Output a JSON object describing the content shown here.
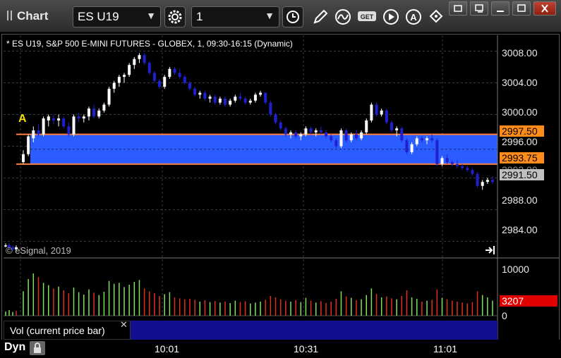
{
  "window": {
    "title": "Chart",
    "symbol": "ES U19",
    "interval": "1"
  },
  "chart": {
    "description": "* ES U19, S&P 500 E-MINI FUTURES - GLOBEX, 1, 09:30-16:15 (Dynamic)",
    "copyright": "© eSignal, 2019",
    "marker": "A",
    "price_axis": [
      "3008.00",
      "3004.00",
      "3000.00",
      "2996.00",
      "2988.00",
      "2984.00"
    ],
    "tags": {
      "upper": "2997.50",
      "lower": "2993.75",
      "last": "2991.50",
      "hidden": "2992.00"
    },
    "volume_axis": [
      "10000",
      "0"
    ],
    "volume_tag": "3207",
    "volume_label": "Vol (current price bar)",
    "time_axis": [
      "10:01",
      "10:31",
      "11:01"
    ],
    "status": "Dyn"
  },
  "colors": {
    "up": "#ffffff",
    "down": "#2020d0",
    "band": "#2a5cff",
    "band_line": "#ff8040",
    "vol_up": "#80e060",
    "vol_down": "#e03020",
    "last_tag": "#c0c0c0",
    "volume_tag": "#e00000"
  },
  "chart_data": {
    "type": "candlestick",
    "title": "* ES U19, S&P 500 E-MINI FUTURES - GLOBEX, 1, 09:30-16:15 (Dynamic)",
    "ylim": [
      2982,
      3010
    ],
    "band": {
      "low": 2993.75,
      "high": 2997.5
    },
    "candles": [
      [
        2983.5,
        2983.75,
        2983.25,
        2983.5
      ],
      [
        2983.5,
        2983.75,
        2983.0,
        2983.25
      ],
      [
        2983.25,
        2983.5,
        2982.75,
        2983.0
      ],
      [
        2983.0,
        2983.5,
        2982.75,
        2983.25
      ],
      [
        2994.0,
        2995.5,
        2993.75,
        2995.0
      ],
      [
        2995.0,
        2997.5,
        2994.75,
        2997.25
      ],
      [
        2997.0,
        2998.5,
        2996.5,
        2998.0
      ],
      [
        2998.0,
        2998.75,
        2997.25,
        2997.5
      ],
      [
        2997.5,
        2999.75,
        2997.25,
        2999.5
      ],
      [
        2999.25,
        3000.0,
        2998.5,
        2999.75
      ],
      [
        2999.5,
        3000.0,
        2998.75,
        2999.25
      ],
      [
        2999.25,
        3000.0,
        2998.5,
        2999.5
      ],
      [
        2999.5,
        2999.75,
        2998.25,
        2998.5
      ],
      [
        2998.5,
        2999.0,
        2997.25,
        2997.5
      ],
      [
        2997.5,
        3000.0,
        2997.25,
        2999.75
      ],
      [
        2999.75,
        3000.25,
        2999.0,
        2999.5
      ],
      [
        2999.5,
        3000.0,
        2999.0,
        2999.75
      ],
      [
        2999.75,
        3001.0,
        2999.25,
        3000.75
      ],
      [
        3000.75,
        3001.25,
        2999.5,
        2999.75
      ],
      [
        2999.75,
        3000.75,
        2999.5,
        3000.5
      ],
      [
        3000.5,
        3001.5,
        3000.25,
        3001.25
      ],
      [
        3001.25,
        3003.5,
        3001.0,
        3003.25
      ],
      [
        3003.25,
        3004.25,
        3002.75,
        3004.0
      ],
      [
        3004.0,
        3005.0,
        3003.5,
        3004.75
      ],
      [
        3004.75,
        3005.25,
        3004.0,
        3005.0
      ],
      [
        3005.0,
        3006.5,
        3004.75,
        3006.25
      ],
      [
        3006.25,
        3007.25,
        3005.75,
        3007.0
      ],
      [
        3007.0,
        3007.75,
        3006.5,
        3007.5
      ],
      [
        3007.5,
        3007.75,
        3006.25,
        3006.5
      ],
      [
        3006.5,
        3006.75,
        3005.0,
        3005.25
      ],
      [
        3005.25,
        3005.5,
        3004.0,
        3004.25
      ],
      [
        3004.25,
        3004.5,
        3003.25,
        3003.5
      ],
      [
        3003.5,
        3005.0,
        3003.25,
        3004.75
      ],
      [
        3004.75,
        3006.0,
        3004.5,
        3005.75
      ],
      [
        3005.75,
        3006.0,
        3005.0,
        3005.25
      ],
      [
        3005.25,
        3005.75,
        3004.5,
        3004.75
      ],
      [
        3004.75,
        3005.0,
        3003.75,
        3004.0
      ],
      [
        3004.0,
        3004.25,
        3003.0,
        3003.25
      ],
      [
        3003.25,
        3003.5,
        3002.25,
        3002.5
      ],
      [
        3002.5,
        3003.0,
        3002.0,
        3002.75
      ],
      [
        3002.75,
        3003.0,
        3001.75,
        3002.0
      ],
      [
        3002.0,
        3002.5,
        3001.5,
        3002.25
      ],
      [
        3002.25,
        3002.5,
        3001.25,
        3001.5
      ],
      [
        3001.5,
        3002.25,
        3001.25,
        3002.0
      ],
      [
        3002.0,
        3002.25,
        3001.0,
        3001.25
      ],
      [
        3001.25,
        3002.0,
        3001.0,
        3001.75
      ],
      [
        3001.75,
        3002.5,
        3001.5,
        3002.25
      ],
      [
        3002.25,
        3002.75,
        3001.75,
        3002.0
      ],
      [
        3002.0,
        3002.25,
        3001.25,
        3001.5
      ],
      [
        3001.5,
        3002.0,
        3001.25,
        3001.75
      ],
      [
        3001.75,
        3002.75,
        3001.5,
        3002.5
      ],
      [
        3002.5,
        3003.0,
        3002.25,
        3002.75
      ],
      [
        3002.75,
        3002.75,
        3001.25,
        3001.5
      ],
      [
        3001.5,
        3001.75,
        2999.75,
        3000.0
      ],
      [
        3000.0,
        3000.25,
        2998.75,
        2999.0
      ],
      [
        2999.0,
        2999.25,
        2998.0,
        2998.25
      ],
      [
        2998.25,
        2998.5,
        2997.25,
        2997.5
      ],
      [
        2997.5,
        2998.0,
        2997.0,
        2997.75
      ],
      [
        2997.75,
        2998.0,
        2997.0,
        2997.25
      ],
      [
        2997.25,
        2997.75,
        2996.75,
        2997.5
      ],
      [
        2997.5,
        2998.5,
        2997.25,
        2998.25
      ],
      [
        2998.25,
        2998.5,
        2997.5,
        2997.75
      ],
      [
        2997.75,
        2998.25,
        2997.25,
        2998.0
      ],
      [
        2998.0,
        2998.5,
        2997.5,
        2997.75
      ],
      [
        2997.75,
        2998.0,
        2997.0,
        2997.25
      ],
      [
        2997.25,
        2997.5,
        2996.5,
        2996.75
      ],
      [
        2996.75,
        2997.0,
        2995.75,
        2996.0
      ],
      [
        2996.0,
        2998.25,
        2995.75,
        2998.0
      ],
      [
        2998.0,
        2998.25,
        2996.5,
        2996.75
      ],
      [
        2996.75,
        2997.75,
        2996.5,
        2997.5
      ],
      [
        2997.5,
        2998.0,
        2996.75,
        2997.0
      ],
      [
        2997.0,
        2998.0,
        2996.75,
        2997.75
      ],
      [
        2997.75,
        2999.5,
        2997.5,
        2999.25
      ],
      [
        2999.25,
        3001.5,
        2999.0,
        3001.25
      ],
      [
        3001.25,
        3001.5,
        2999.75,
        3000.0
      ],
      [
        3000.0,
        3000.75,
        2999.75,
        3000.5
      ],
      [
        3000.5,
        3000.75,
        2998.75,
        2999.0
      ],
      [
        2999.0,
        2999.25,
        2997.75,
        2998.0
      ],
      [
        2998.0,
        2998.5,
        2997.25,
        2998.25
      ],
      [
        2998.25,
        2998.5,
        2996.5,
        2996.75
      ],
      [
        2996.75,
        2997.0,
        2995.0,
        2995.25
      ],
      [
        2995.25,
        2996.5,
        2995.0,
        2996.25
      ],
      [
        2996.25,
        2997.25,
        2996.0,
        2997.0
      ],
      [
        2997.0,
        2997.25,
        2996.5,
        2996.75
      ],
      [
        2996.75,
        2997.25,
        2996.25,
        2997.0
      ],
      [
        2997.0,
        2997.5,
        2996.5,
        2996.75
      ],
      [
        2996.75,
        2997.0,
        2993.5,
        2993.75
      ],
      [
        2993.75,
        2994.75,
        2993.5,
        2994.5
      ],
      [
        2994.5,
        2995.0,
        2993.75,
        2994.0
      ],
      [
        2994.0,
        2994.25,
        2993.5,
        2993.75
      ],
      [
        2993.75,
        2994.25,
        2993.25,
        2993.5
      ],
      [
        2993.5,
        2993.75,
        2993.0,
        2993.25
      ],
      [
        2993.25,
        2993.5,
        2992.75,
        2993.0
      ],
      [
        2993.0,
        2993.25,
        2992.25,
        2992.5
      ],
      [
        2992.5,
        2992.75,
        2990.75,
        2991.0
      ],
      [
        2991.0,
        2991.75,
        2990.5,
        2991.5
      ],
      [
        2991.5,
        2992.0,
        2991.25,
        2991.75
      ],
      [
        2991.75,
        2992.25,
        2991.25,
        2991.5
      ]
    ],
    "volume": [
      [
        900,
        1
      ],
      [
        1200,
        1
      ],
      [
        800,
        1
      ],
      [
        1000,
        0
      ],
      [
        5200,
        1
      ],
      [
        7800,
        1
      ],
      [
        9000,
        1
      ],
      [
        8200,
        0
      ],
      [
        7000,
        1
      ],
      [
        6500,
        1
      ],
      [
        5800,
        0
      ],
      [
        6200,
        1
      ],
      [
        5400,
        0
      ],
      [
        4800,
        0
      ],
      [
        6000,
        1
      ],
      [
        5000,
        1
      ],
      [
        4500,
        1
      ],
      [
        5600,
        1
      ],
      [
        4900,
        0
      ],
      [
        4400,
        1
      ],
      [
        5100,
        1
      ],
      [
        7400,
        1
      ],
      [
        6800,
        1
      ],
      [
        7000,
        1
      ],
      [
        6100,
        1
      ],
      [
        6600,
        1
      ],
      [
        7200,
        1
      ],
      [
        7600,
        1
      ],
      [
        5800,
        0
      ],
      [
        5200,
        0
      ],
      [
        4800,
        0
      ],
      [
        4200,
        0
      ],
      [
        4600,
        1
      ],
      [
        5000,
        1
      ],
      [
        3900,
        0
      ],
      [
        3700,
        0
      ],
      [
        3500,
        0
      ],
      [
        3600,
        0
      ],
      [
        3400,
        0
      ],
      [
        3000,
        1
      ],
      [
        3300,
        0
      ],
      [
        2900,
        1
      ],
      [
        3100,
        0
      ],
      [
        2800,
        1
      ],
      [
        3000,
        0
      ],
      [
        2700,
        1
      ],
      [
        3200,
        1
      ],
      [
        2900,
        0
      ],
      [
        3100,
        0
      ],
      [
        2600,
        1
      ],
      [
        2800,
        1
      ],
      [
        3000,
        1
      ],
      [
        3400,
        0
      ],
      [
        4200,
        0
      ],
      [
        3900,
        0
      ],
      [
        3500,
        0
      ],
      [
        3200,
        0
      ],
      [
        3000,
        1
      ],
      [
        3300,
        0
      ],
      [
        2900,
        1
      ],
      [
        3800,
        1
      ],
      [
        3200,
        0
      ],
      [
        2800,
        1
      ],
      [
        3100,
        0
      ],
      [
        2700,
        0
      ],
      [
        3000,
        0
      ],
      [
        3600,
        0
      ],
      [
        5200,
        1
      ],
      [
        4100,
        0
      ],
      [
        3800,
        1
      ],
      [
        3300,
        0
      ],
      [
        3500,
        1
      ],
      [
        4400,
        1
      ],
      [
        5800,
        1
      ],
      [
        4600,
        0
      ],
      [
        3900,
        1
      ],
      [
        4100,
        0
      ],
      [
        3700,
        0
      ],
      [
        3500,
        1
      ],
      [
        4200,
        0
      ],
      [
        5400,
        0
      ],
      [
        3900,
        1
      ],
      [
        3600,
        1
      ],
      [
        3000,
        0
      ],
      [
        3200,
        1
      ],
      [
        3400,
        0
      ],
      [
        5600,
        0
      ],
      [
        3800,
        1
      ],
      [
        3500,
        0
      ],
      [
        3200,
        0
      ],
      [
        3000,
        0
      ],
      [
        2800,
        0
      ],
      [
        2600,
        0
      ],
      [
        2900,
        0
      ],
      [
        5200,
        0
      ],
      [
        4400,
        1
      ],
      [
        3900,
        1
      ],
      [
        3207,
        1
      ]
    ],
    "volume_ylim": [
      0,
      12000
    ]
  }
}
